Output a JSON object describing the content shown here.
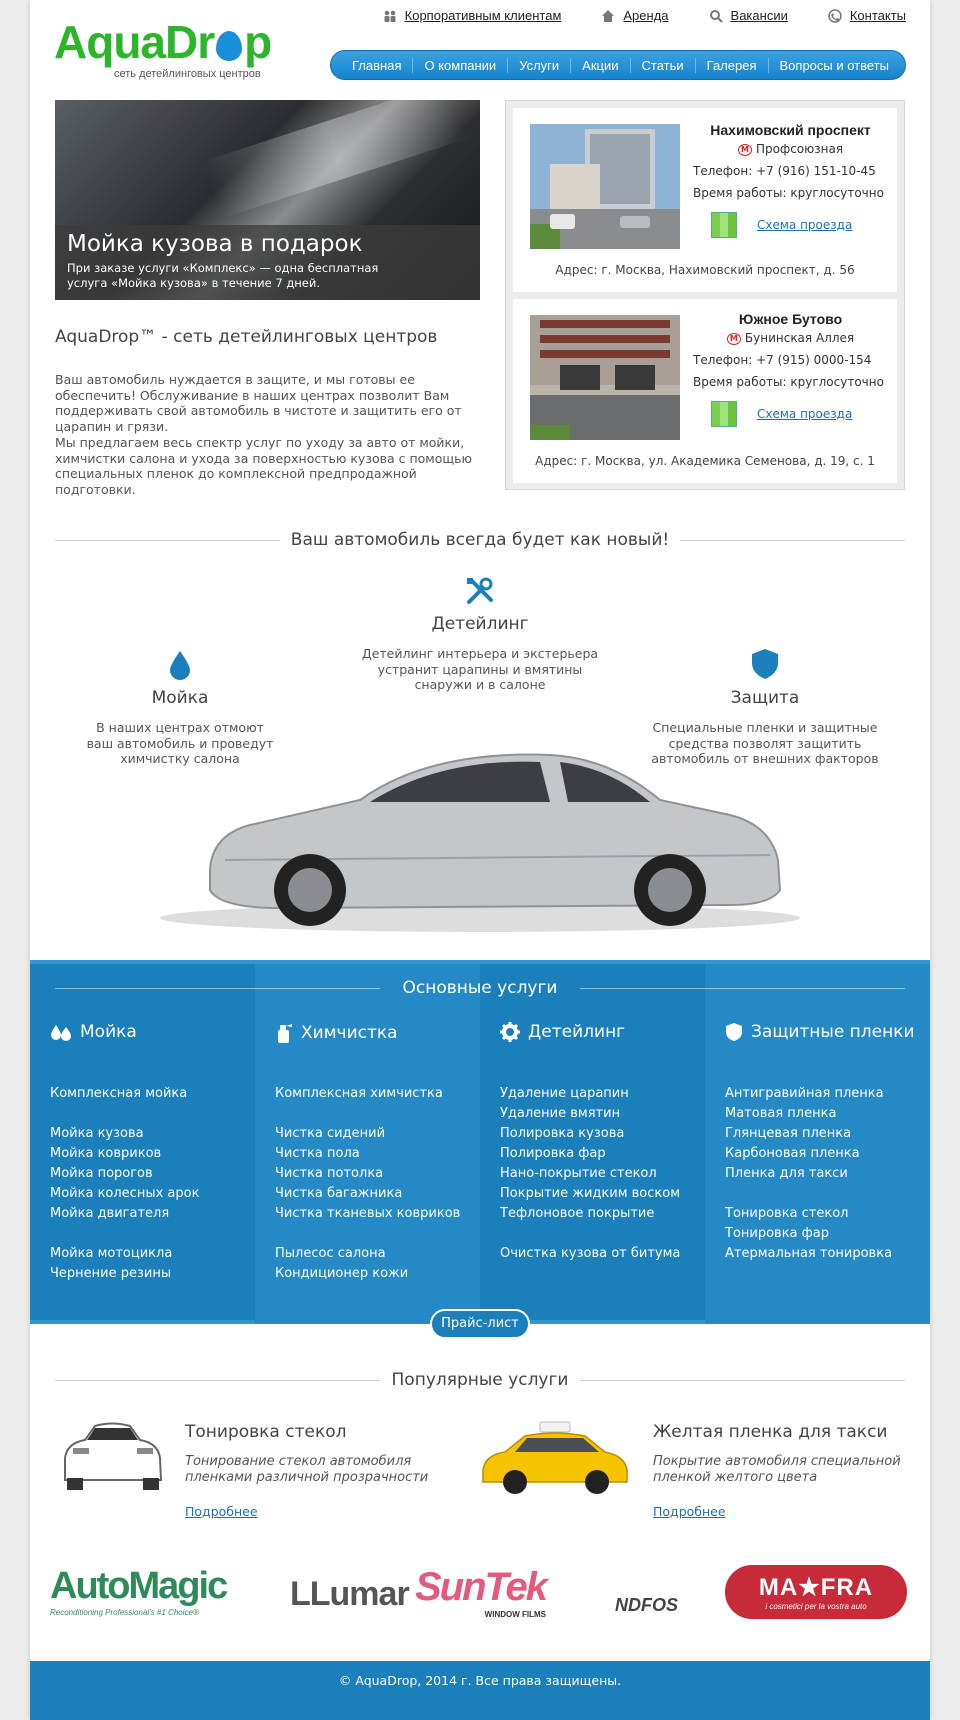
{
  "header": {
    "logo_text_1": "AquaDr",
    "logo_text_2": "p",
    "logo_subtitle": "сеть детейлинговых центров",
    "top_links": [
      "Корпоративным клиентам",
      "Аренда",
      "Вакансии",
      "Контакты"
    ],
    "nav": [
      "Главная",
      "О компании",
      "Услуги",
      "Акции",
      "Статьи",
      "Галерея",
      "Вопросы и ответы"
    ]
  },
  "hero": {
    "title": "Мойка кузова в подарок",
    "text": "При заказе услуги «Комплекс» — одна бесплатная услуга «Мойка кузова» в течение 7 дней."
  },
  "intro": {
    "title": "AquaDrop™ - сеть детейлинговых центров",
    "p1": "Ваш автомобиль нуждается в защите, и мы готовы ее обеспечить! Обслуживание в наших центрах позволит Вам поддерживать свой автомобиль в чистоте и защитить его от царапин и грязи.",
    "p2": "Мы предлагаем весь спектр услуг по уходу за авто от мойки, химчистки салона и ухода за поверхностью кузова с помощью специальных пленок до комплексной предпродажной подготовки."
  },
  "locations": [
    {
      "name": "Нахимовский проспект",
      "metro": "Профсоюзная",
      "phone": "Телефон: +7 (916) 151-10-45",
      "hours": "Время работы: круглосуточно",
      "scheme": "Схема проезда",
      "address": "Адрес: г. Москва, Нахимовский проспект, д. 56"
    },
    {
      "name": "Южное Бутово",
      "metro": "Бунинская Аллея",
      "phone": "Телефон: +7 (915) 0000-154",
      "hours": "Время работы: круглосуточно",
      "scheme": "Схема проезда",
      "address": "Адрес: г. Москва, ул. Академика Семенова, д. 19, с. 1"
    }
  ],
  "features": {
    "section_title": "Ваш автомобиль всегда будет как новый!",
    "detailing": {
      "title": "Детейлинг",
      "text": "Детейлинг интерьера и экстерьера устранит царапины и вмятины снаружи и в салоне"
    },
    "wash": {
      "title": "Мойка",
      "text": "В наших центрах отмоют ваш автомобиль и проведут химчистку салона"
    },
    "protection": {
      "title": "Защита",
      "text": "Специальные пленки и защитные средства позволят защитить автомобиль от внешних факторов"
    }
  },
  "services": {
    "title": "Основные услуги",
    "columns": [
      {
        "title": "Мойка",
        "items": [
          "Комплексная мойка",
          "",
          "Мойка кузова",
          "Мойка ковриков",
          "Мойка порогов",
          "Мойка колесных арок",
          "Мойка двигателя",
          "",
          "Мойка мотоцикла",
          "Чернение резины"
        ]
      },
      {
        "title": "Химчистка",
        "items": [
          "Комплексная химчистка",
          "",
          "Чистка сидений",
          "Чистка пола",
          "Чистка потолка",
          "Чистка багажника",
          "Чистка тканевых ковриков",
          "",
          "Пылесос салона",
          "Кондиционер кожи"
        ]
      },
      {
        "title": "Детейлинг",
        "items": [
          "Удаление царапин",
          "Удаление вмятин",
          "Полировка кузова",
          "Полировка фар",
          "Нано-покрытие стекол",
          "Покрытие жидким воском",
          "Тефлоновое покрытие",
          "",
          "Очистка кузова от битума"
        ]
      },
      {
        "title": "Защитные пленки",
        "items": [
          "Антигравийная пленка",
          "Матовая пленка",
          "Глянцевая пленка",
          "Карбоновая пленка",
          "Пленка для такси",
          "",
          "Тонировка стекол",
          "Тонировка фар",
          "Атермальная тонировка"
        ]
      }
    ],
    "price_button": "Прайс-лист"
  },
  "popular": {
    "title": "Популярные услуги",
    "items": [
      {
        "title": "Тонировка стекол",
        "text": "Тонирование стекол автомобиля пленками различной прозрачности",
        "link": "Подробнее"
      },
      {
        "title": "Желтая пленка для такси",
        "text": "Покрытие автомобиля специальной пленкой желтого цвета",
        "link": "Подробнее"
      }
    ]
  },
  "brands": {
    "automagic": "AutoMagic",
    "automagic_sub": "Reconditioning Professional's #1 Choice®",
    "llumar": "LLumar",
    "suntek": "SunTek",
    "suntek_sub": "WINDOW FILMS",
    "ndfos": "NDFOS",
    "mafra": "MA★FRA",
    "mafra_sub": "i cosmetici per la vostra auto"
  },
  "footer": {
    "copyright": "© AquaDrop, 2014 г. Все права защищены."
  },
  "colors": {
    "brand_green": "#2cb52a",
    "brand_blue": "#1b7fbb",
    "nav_blue": "#1683cc"
  }
}
